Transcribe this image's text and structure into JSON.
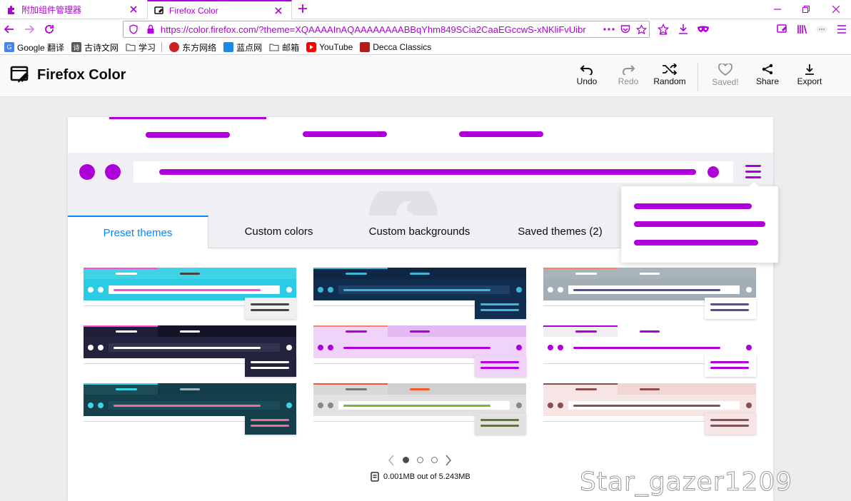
{
  "browser": {
    "tabs": [
      {
        "title": "附加组件管理器",
        "active": false
      },
      {
        "title": "Firefox Color",
        "active": true
      }
    ],
    "url_prefix": "https://color.",
    "url_domain": "firefox.com",
    "url_rest": "/?theme=XQAAAAInAQAAAAAAAABBqYhm849SCia2CaaEGccwS-xNKliFvUibr",
    "bookmarks": [
      {
        "label": "Google 翻译",
        "color": "#4285f4"
      },
      {
        "label": "古诗文网",
        "color": "#5a5a5a"
      },
      {
        "label": "学习",
        "folder": true
      },
      {
        "label": "东方网络",
        "color": "#cc2222"
      },
      {
        "label": "蓝点网",
        "color": "#1e88e5"
      },
      {
        "label": "邮箱",
        "folder": true
      },
      {
        "label": "YouTube",
        "color": "#ff0000"
      },
      {
        "label": "Decca Classics",
        "color": "#b71c1c"
      }
    ],
    "accent": "#b000d9"
  },
  "app": {
    "title": "Firefox Color",
    "actions": {
      "undo": "Undo",
      "redo": "Redo",
      "random": "Random",
      "saved": "Saved!",
      "share": "Share",
      "export": "Export"
    }
  },
  "editor": {
    "tabs": [
      "Preset themes",
      "Custom colors",
      "Custom backgrounds",
      "Saved themes (2)"
    ],
    "active_tab": 0,
    "presets": [
      {
        "frame": "#3fd3e5",
        "tab": "#3fd3e5",
        "toolbar": "#2acce3",
        "url": "#ffffff",
        "text": "#ff4bd2",
        "icon": "#ffffff",
        "popup": "#f0f0f0",
        "popup_text": "#444444",
        "active": "#ff4bd2",
        "bgtext": "#ffffff",
        "inactive_text": "#444444"
      },
      {
        "frame": "#0f2744",
        "tab": "#0f2744",
        "toolbar": "#112d4f",
        "url": "#1e3f66",
        "text": "#3fb6d8",
        "icon": "#3fb6d8",
        "popup": "#112d4f",
        "popup_text": "#3fb6d8",
        "active": "#3fb6d8",
        "bgtext": "#3fb6d8",
        "inactive_text": "#3fb6d8"
      },
      {
        "frame": "#a7b4bc",
        "tab": "#a7b4bc",
        "toolbar": "#a2adb5",
        "url": "#ffffff",
        "text": "#5b4b9e",
        "icon": "#ffffff",
        "popup": "#ffffff",
        "popup_text": "#5b4b9e",
        "active": "#f58461",
        "bgtext": "#ffffff",
        "inactive_text": "#ffffff"
      },
      {
        "frame": "#141428",
        "tab": "#1f1f3a",
        "toolbar": "#23233d",
        "url": "#33334f",
        "text": "#ffffff",
        "icon": "#ffffff",
        "popup": "#23233d",
        "popup_text": "#ffffff",
        "active": "#ff4bd2",
        "bgtext": "#ffffff",
        "inactive_text": "#ffffff"
      },
      {
        "frame": "#e4b8f2",
        "tab": "#efd3f8",
        "toolbar": "#efd3f8",
        "url": "#efd3f8",
        "text": "#b000d9",
        "icon": "#b000d9",
        "popup": "#efd3f8",
        "popup_text": "#b000d9",
        "active": "#f58461",
        "bgtext": "#b000d9",
        "inactive_text": "#b000d9"
      },
      {
        "frame": "#ffffff",
        "tab": "#f0f0f4",
        "toolbar": "#ffffff",
        "url": "#ffffff",
        "text": "#b000d9",
        "icon": "#b000d9",
        "popup": "#ffffff",
        "popup_text": "#b000d9",
        "active": "#b000d9",
        "bgtext": "#b000d9",
        "inactive_text": "#b000d9"
      },
      {
        "frame": "#123c48",
        "tab": "#1b4c58",
        "toolbar": "#15404b",
        "url": "#1b4c58",
        "text": "#f26f8f",
        "icon": "#3fd3e5",
        "popup": "#15404b",
        "popup_text": "#f26f8f",
        "active": "#3fd3e5",
        "bgtext": "#3fd3e5",
        "inactive_text": "#9eb4ba"
      },
      {
        "frame": "#d0d0d0",
        "tab": "#d8d8d8",
        "toolbar": "#e2e2e2",
        "url": "#ffffff",
        "text": "#7fb03a",
        "icon": "#888888",
        "popup": "#e2e2e2",
        "popup_text": "#5a7a2a",
        "active": "#ef5a2f",
        "bgtext": "#777777",
        "inactive_text": "#ef5a2f"
      },
      {
        "frame": "#f1d6d6",
        "tab": "#f7e5e5",
        "toolbar": "#f7e5e5",
        "url": "#ffffff",
        "text": "#8a4e4e",
        "icon": "#8a4e4e",
        "popup": "#f7e5e5",
        "popup_text": "#8a4e4e",
        "active": "#8a4e4e",
        "bgtext": "#8a4e4e",
        "inactive_text": "#8a4e4e"
      }
    ],
    "pager": {
      "pages": 3,
      "current": 0
    },
    "storage": "0.001MB out of 5.243MB"
  },
  "watermark": "Star_gazer1209"
}
